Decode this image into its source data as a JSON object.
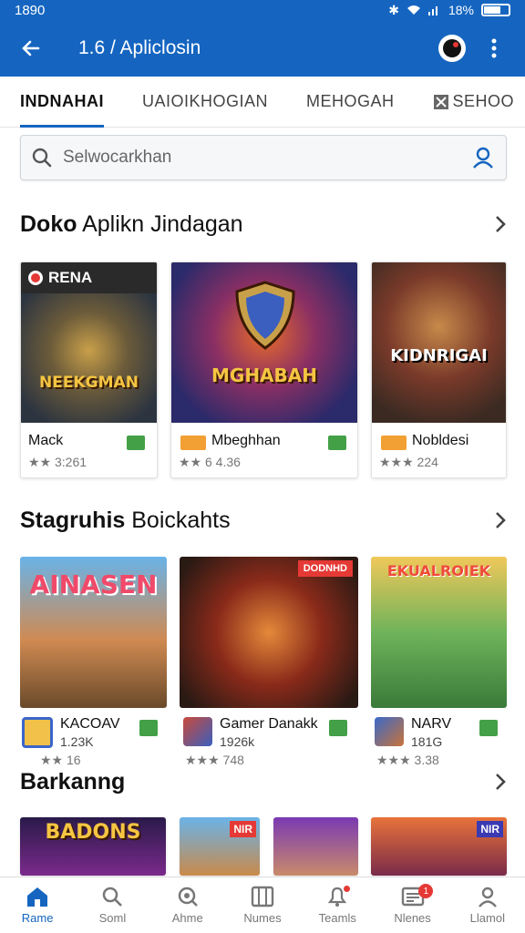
{
  "status_bar": {
    "time": "1890",
    "battery": "18%"
  },
  "app_bar": {
    "title": "1.6 / Apliclosin"
  },
  "tabs": [
    {
      "label": "INDNAHAI",
      "active": true
    },
    {
      "label": "UAIOIKHOGIAN"
    },
    {
      "label": "MEHOGAH"
    },
    {
      "label": "SEHOO"
    }
  ],
  "search": {
    "placeholder": "Selwocarkhan"
  },
  "section1": {
    "title_bold": "Doko",
    "title_rest": " Aplikn Jindagan",
    "cards": [
      {
        "art_label": "NEEKGMAN",
        "corner_label": "RENA",
        "name": "Mack",
        "rating": "★★ 3:261"
      },
      {
        "art_label": "MGHABAH",
        "name": "Mbeghhan",
        "rating": "★★ 6 4.36"
      },
      {
        "art_label": "KIDNRIGAI",
        "name": "Nobldesi",
        "rating": "★★★ 224"
      }
    ]
  },
  "section2": {
    "title_bold": "Stagruhis",
    "title_rest": " Boickahts",
    "cards": [
      {
        "art_label": "AINASEN",
        "name": "KACOAV",
        "sub": "1.23K",
        "rating": "★★ 16"
      },
      {
        "art_label": "",
        "corner_label": "DODNHD",
        "name": "Gamer Danakk",
        "sub": "1926k",
        "rating": "★★★ 748"
      },
      {
        "art_label": "EKUALROIEK",
        "name": "NARV",
        "sub": "181G",
        "rating": "★★★ 3.38"
      }
    ]
  },
  "section3": {
    "title_bold": "Barkanng",
    "cards": [
      {
        "art_label": "BADONS"
      },
      {
        "art_label": "NIR"
      },
      {
        "art_label": ""
      },
      {
        "art_label": "NIR"
      }
    ]
  },
  "bottom_nav": [
    {
      "label": "Rame",
      "active": true
    },
    {
      "label": "Soml"
    },
    {
      "label": "Ahme"
    },
    {
      "label": "Numes"
    },
    {
      "label": "Teamls"
    },
    {
      "label": "Nlenes",
      "badge": "1"
    },
    {
      "label": "Llamol"
    }
  ]
}
